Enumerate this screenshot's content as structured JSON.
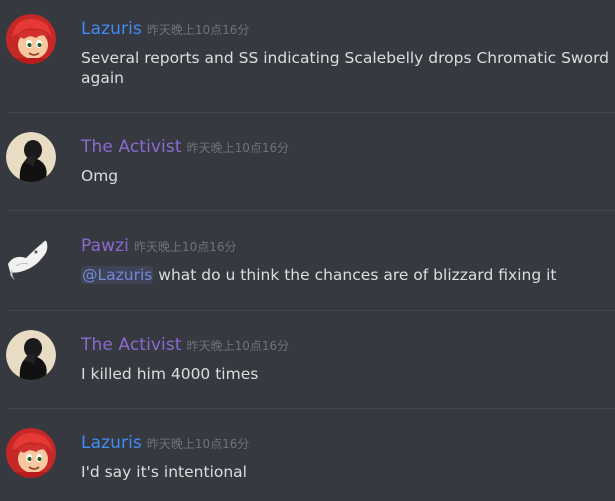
{
  "messages": [
    {
      "author": "Lazuris",
      "timestamp": "昨天晚上10点16分",
      "lines": [
        "Several reports and SS indicating Scalebelly drops Chromatic Sword",
        "again"
      ]
    },
    {
      "author": "The Activist",
      "timestamp": "昨天晚上10点16分",
      "lines": [
        "Omg"
      ]
    },
    {
      "author": "Pawzi",
      "timestamp": "昨天晚上10点16分",
      "mention": "@Lazuris",
      "text": " what do u think the chances are of blizzard fixing it"
    },
    {
      "author": "The Activist",
      "timestamp": "昨天晚上10点16分",
      "lines": [
        "I killed him 4000 times"
      ]
    },
    {
      "author": "Lazuris",
      "timestamp": "昨天晚上10点16分",
      "lines": [
        "I'd say it's intentional"
      ]
    }
  ],
  "colors": {
    "background": "#36393f",
    "username_blue": "#3f8cf5",
    "username_purple": "#8a6ad1",
    "text": "#dcddde",
    "timestamp": "#6f7378",
    "mention": "#7289da"
  },
  "icons": {
    "lazuris_avatar": "red-haired-cartoon-avatar",
    "activist_avatar": "silhouette-portrait-avatar",
    "pawzi_avatar": "white-wolf-avatar"
  }
}
